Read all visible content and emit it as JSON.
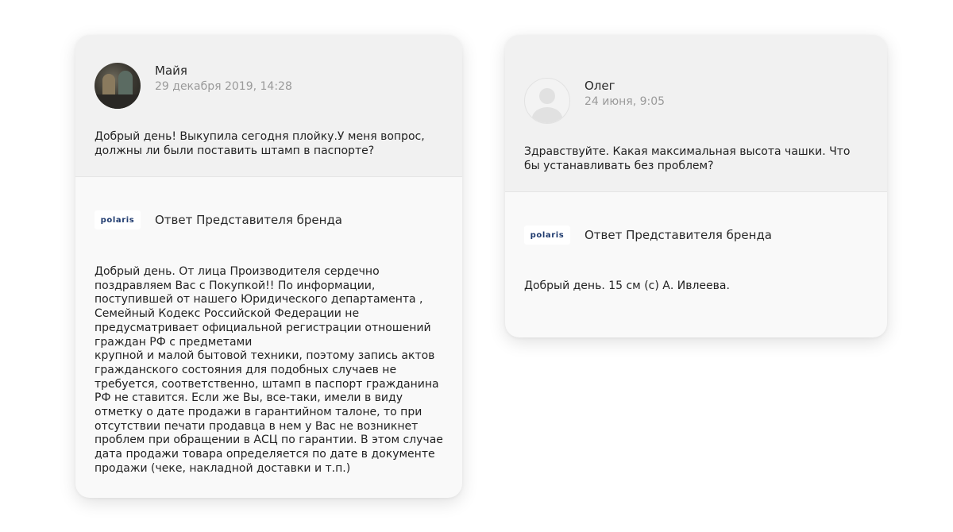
{
  "reviews": [
    {
      "author": "Майя",
      "date": "29 декабря 2019, 14:28",
      "avatar": "user-photo",
      "question": "Добрый день! Выкупила сегодня плойку.У меня вопрос, должны ли были поставить штамп в паспорте?",
      "brand_logo": "polaris",
      "brand_label": "Ответ Представителя бренда",
      "answer": "Добрый день.  От лица Производителя сердечно поздравляем Вас с Покупкой!!  По информации, поступившей от нашего Юридического департамента , Семейный Кодекс Российской Федерации не предусматривает официальной регистрации отношений граждан РФ с предметами\nкрупной и малой бытовой техники, поэтому запись актов гражданского состояния для подобных случаев не требуется, соответственно, штамп в паспорт гражданина РФ не ставится.  Если же Вы, все-таки,  имели в виду отметку о дате продажи в гарантийном талоне, то при отсутствии печати продавца в нем у Вас не возникнет проблем при обращении в АСЦ по гарантии.  В этом случае дата продажи товара определяется по дате в документе продажи (чеке, накладной доставки и т.п.)"
    },
    {
      "author": "Олег",
      "date": "24 июня, 9:05",
      "avatar": "default-user-icon",
      "question": "Здравствуйте. Какая максимальная высота чашки. Что бы устанавливать без проблем?",
      "brand_logo": "polaris",
      "brand_label": "Ответ Представителя бренда",
      "answer": "Добрый день.  15 см (с) А. Ивлеева."
    }
  ]
}
